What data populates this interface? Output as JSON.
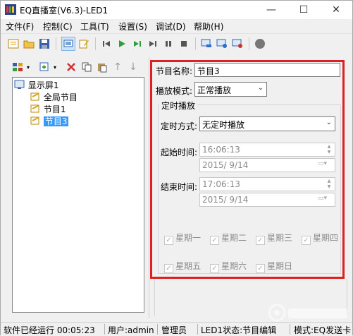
{
  "window": {
    "title": "EQ直播室(V6.3)-LED1",
    "minimize_glyph": "—",
    "maximize_glyph": "☐",
    "close_glyph": "✕"
  },
  "menu": [
    "文件(F)",
    "控制(C)",
    "工具(T)",
    "设置(S)",
    "调试(D)",
    "帮助(H)"
  ],
  "toolbar_icons": [
    "new-icon",
    "open-folder-icon",
    "save-icon",
    "screen-icon",
    "edit-icon",
    "first-icon",
    "play-icon",
    "step-icon",
    "next-icon",
    "pause-icon",
    "stop-icon",
    "send-icon",
    "send-all-icon",
    "screen-config-icon",
    "record-icon"
  ],
  "tree": {
    "root": "显示屏1",
    "children": [
      "全局节目",
      "节目1",
      "节目3"
    ],
    "selected": "节目3"
  },
  "form": {
    "program_name_label": "节目名称:",
    "program_name_value": "节目3",
    "play_mode_label": "播放模式:",
    "play_mode_value": "正常播放",
    "schedule_group": "定时播放",
    "schedule_mode_label": "定时方式:",
    "schedule_mode_value": "无定时播放",
    "start_time_label": "起始时间:",
    "start_time_value": "16:06:13",
    "start_date_value": "2015/  9/14",
    "end_time_label": "结束时间:",
    "end_time_value": "17:06:13",
    "end_date_value": "2015/  9/14",
    "weekdays": [
      "星期一",
      "星期二",
      "星期三",
      "星期四",
      "星期五",
      "星期六",
      "星期日"
    ]
  },
  "status": {
    "runtime": "软件已经运行 00:05:23",
    "user": "用户:admin",
    "role": "管理员",
    "led_status": "LED1状态:节目编辑",
    "mode": "模式:EQ发送卡"
  },
  "colors": {
    "highlight_border": "#e02020",
    "selection": "#3399ff"
  }
}
